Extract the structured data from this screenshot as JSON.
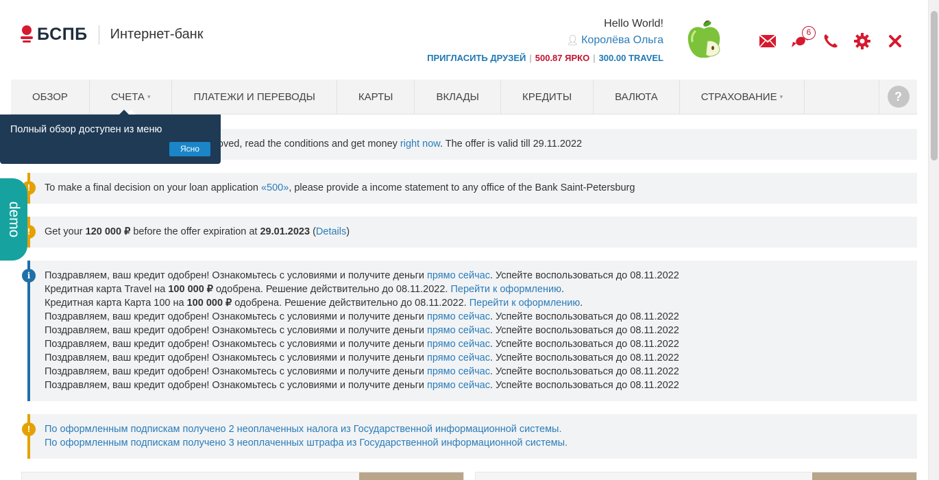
{
  "brand": {
    "name": "БСПБ",
    "subtitle": "Интернет-банк",
    "color": "#d7192e"
  },
  "user": {
    "greeting": "Hello World!",
    "name": "Королёва Ольга",
    "invite": "ПРИГЛАСИТЬ ДРУЗЕЙ",
    "yarko": "500.87 ЯРКО",
    "travel": "300.00 TRAVEL",
    "sep": "|"
  },
  "header_icons": [
    {
      "name": "mail-icon"
    },
    {
      "name": "candy-icon",
      "badge": "6"
    },
    {
      "name": "phone-icon"
    },
    {
      "name": "gear-icon"
    },
    {
      "name": "close-icon"
    }
  ],
  "nav": {
    "items": [
      {
        "label": "ОБЗОР"
      },
      {
        "label": "СЧЕТА",
        "dropdown": true
      },
      {
        "label": "ПЛАТЕЖИ И ПЕРЕВОДЫ"
      },
      {
        "label": "КАРТЫ"
      },
      {
        "label": "ВКЛАДЫ"
      },
      {
        "label": "КРЕДИТЫ"
      },
      {
        "label": "ВАЛЮТА"
      },
      {
        "label": "СТРАХОВАНИЕ",
        "dropdown": true
      }
    ],
    "help": "?"
  },
  "tooltip": {
    "text": "Полный обзор доступен из меню",
    "button": "Ясно"
  },
  "demo_label": "demo",
  "notices": {
    "n1": {
      "t1": "proved, read the conditions and get money ",
      "link": "right now",
      "t2": ". The offer is valid till 29.11.2022"
    },
    "n2": {
      "t1": "To make a final decision on your loan application ",
      "link": "«500»",
      "t2": ", please provide a income statement to any office of the Bank Saint-Petersburg"
    },
    "n3": {
      "t1": "Get your ",
      "b1": "120 000 ₽",
      "t2": " before the offer expiration at ",
      "b2": "29.01.2023",
      "t3": " (",
      "link": "Details",
      "t4": ")"
    },
    "n4": {
      "congrats_a": "Поздравляем, ваш кредит одобрен! Ознакомьтесь с условиями и получите деньги ",
      "congrats_link": "прямо сейчас",
      "congrats_b": ". Успейте воспользоваться до 08.11.2022",
      "travel_a": "Кредитная карта Travel на ",
      "card100_a": "Кредитная карта Карта 100 на ",
      "amount": "100 000 ₽",
      "approved": " одобрена. Решение действительно до 08.11.2022. ",
      "apply_link": "Перейти к оформлению",
      "dot": "."
    },
    "n5": {
      "l1": "По оформленным подпискам получено 2 неоплаченных налога из Государственной информационной системы.",
      "l2": "По оформленным подпискам получено 3 неоплаченных штрафа из Государственной информационной системы."
    }
  },
  "colors": {
    "accent": "#2b7cb8",
    "warning": "#e5a100",
    "info": "#1f6fa8",
    "demo": "#16a3a0",
    "tooltip": "#1f3a55"
  }
}
